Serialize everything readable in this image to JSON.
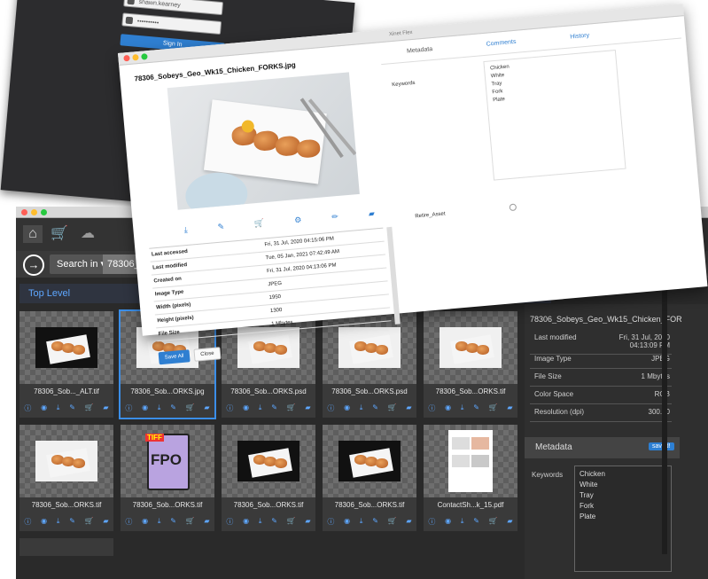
{
  "login": {
    "username": "shawn.kearney",
    "password": "••••••••••",
    "sign_in": "Sign In"
  },
  "main": {
    "search_in": "Search in ▾",
    "search_value": "78306_Sob",
    "top_level": "Top Level",
    "tiles": [
      {
        "name": "78306_Sob..._ALT.tif",
        "bg": "dark"
      },
      {
        "name": "78306_Sob...ORKS.jpg",
        "bg": "white",
        "selected": true
      },
      {
        "name": "78306_Sob...ORKS.psd",
        "bg": "white"
      },
      {
        "name": "78306_Sob...ORKS.psd",
        "bg": "white"
      },
      {
        "name": "78306_Sob...ORKS.tif",
        "bg": "white"
      },
      {
        "name": "78306_Sob...ORKS.tif",
        "bg": "white"
      },
      {
        "name": "78306_Sob...ORKS.tif",
        "bg": "fpo"
      },
      {
        "name": "78306_Sob...ORKS.tif",
        "bg": "dark"
      },
      {
        "name": "78306_Sob...ORKS.tif",
        "bg": "dark"
      },
      {
        "name": "ContactSh...k_15.pdf",
        "bg": "doc"
      }
    ],
    "fpo_label": "FPO",
    "tiff_label": "TIFF",
    "right_panel": {
      "title": "78306_Sobeys_Geo_Wk15_Chicken_FORKS.jpg",
      "rows": [
        {
          "k": "Last modified",
          "v": "Fri, 31 Jul, 2020 04:13:09 PM"
        },
        {
          "k": "Image Type",
          "v": "JPEG"
        },
        {
          "k": "File Size",
          "v": "1 Mbytes"
        },
        {
          "k": "Color Space",
          "v": "RGB"
        },
        {
          "k": "Resolution (dpi)",
          "v": "300.00"
        }
      ],
      "metadata_title": "Metadata",
      "saved_badge": "saved!",
      "keywords_label": "Keywords",
      "keywords": [
        "Chicken",
        "White",
        "Tray",
        "Fork",
        "Plate"
      ]
    }
  },
  "dialog": {
    "window_title": "Xinet Flex",
    "file_name": "78306_Sobeys_Geo_Wk15_Chicken_FORKS.jpg",
    "tabs": [
      "Metadata",
      "Comments",
      "History"
    ],
    "active_tab": "Metadata",
    "props": [
      {
        "k": "Last accessed",
        "v": "Fri, 31 Jul, 2020 04:15:06 PM"
      },
      {
        "k": "Last modified",
        "v": "Tue, 05 Jan, 2021 07:42:49 AM"
      },
      {
        "k": "Created on",
        "v": "Fri, 31 Jul, 2020 04:13:06 PM"
      },
      {
        "k": "Image Type",
        "v": "JPEG"
      },
      {
        "k": "Width (pixels)",
        "v": "1950"
      },
      {
        "k": "Height (pixels)",
        "v": "1300"
      },
      {
        "k": "File Size",
        "v": "1 Mbytes"
      }
    ],
    "keywords_label": "Keywords",
    "keywords": [
      "Chicken",
      "White",
      "Tray",
      "Fork",
      "Plate"
    ],
    "retire_label": "Retire_Asset",
    "save_all": "Save All",
    "close": "Close",
    "footer_file": "ContactSh...k_15.pdf"
  }
}
